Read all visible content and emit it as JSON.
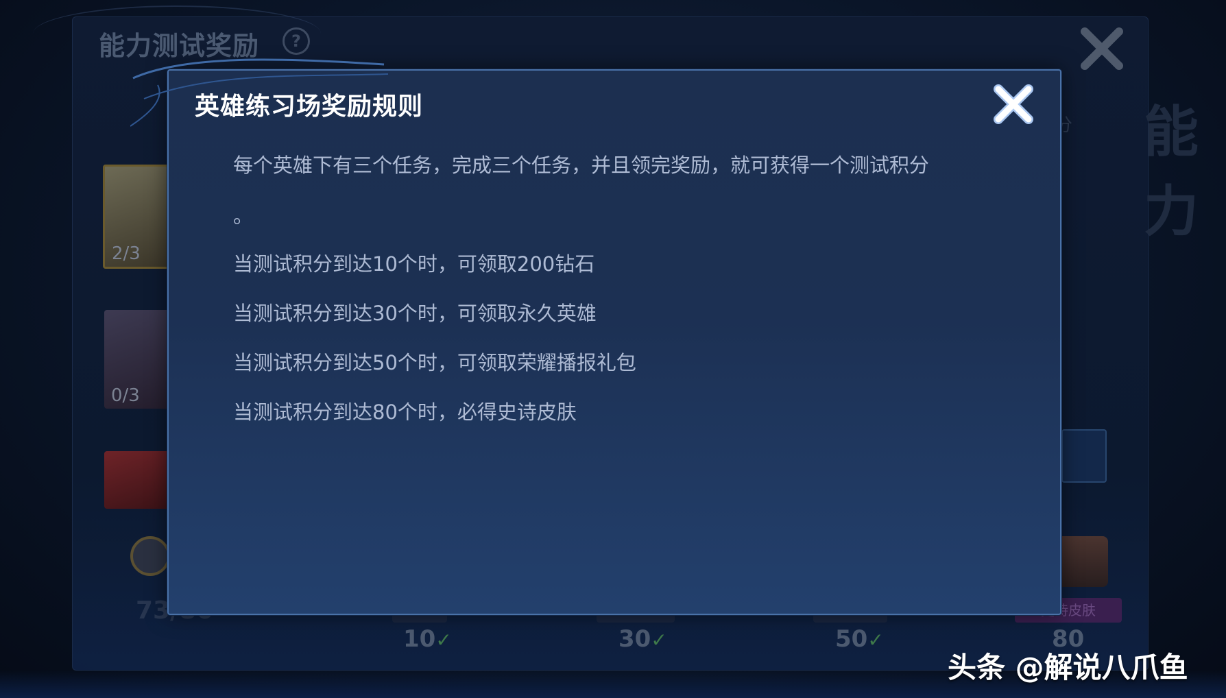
{
  "background": {
    "title": "能力测试奖励",
    "help_icon": "question-circle-icon",
    "right_fragment": "分",
    "right_big_fragment": "能力",
    "cards": [
      {
        "count": "2/3"
      },
      {
        "count": "0/3"
      },
      {
        "count": ""
      }
    ],
    "progress": "73/80",
    "milestones": [
      {
        "value": "10",
        "checked": true
      },
      {
        "value": "30",
        "checked": true
      },
      {
        "value": "50",
        "checked": true
      },
      {
        "value": "80",
        "checked": false
      }
    ],
    "epic_tag": "史诗皮肤"
  },
  "modal": {
    "title": "英雄练习场奖励规则",
    "close_icon": "close-x-icon",
    "rules": [
      "每个英雄下有三个任务，完成三个任务，并且领完奖励，就可获得一个测试积分",
      "。",
      "当测试积分到达10个时，可领取200钻石",
      "当测试积分到达30个时，可领取永久英雄",
      "当测试积分到达50个时，可领取荣耀播报礼包",
      "当测试积分到达80个时，必得史诗皮肤"
    ]
  },
  "watermark": "头条 @解说八爪鱼",
  "colors": {
    "modal_bg": "#1c3053",
    "modal_border": "#4a72a8",
    "title_text": "#ffffff",
    "rule_text": "#aebbd4"
  }
}
